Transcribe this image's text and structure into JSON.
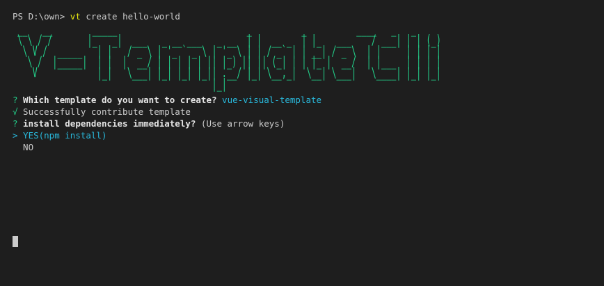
{
  "prompt": {
    "text": "PS D:\\own> ",
    "command": "vt",
    "args": " create hello-world"
  },
  "banner": {
    "art": " __   __        _____                          _          _          ____   _   _\n \\ \\ / /       |_   _|  ___   _ __ ___   _ __  | |  __ _  | |_   ___    / ___| | | (_)\n  \\ V /  _____   | |   / _ \\ | '_ ` _ \\ | '_ \\ | | / _` | | __| / _ \\  | |     | | | |\n   \\ /  |_____|  | |  |  __/ | | | | | || |_) || || (_| | | |_ |  __/  | |___  | | | |\n    V            |_|   \\___| |_| |_| |_|| .__/ |_| \\__,_|  \\__| \\___|   \\____| |_| |_|\n                                        |_|"
  },
  "output": {
    "q1_mark": "?",
    "q1_question": " Which template do you want to create?",
    "q1_answer": " vue-visual-template",
    "success_mark": "√",
    "success_text": " Successfully contribute template",
    "q2_mark": "?",
    "q2_question": " install dependencies immediately?",
    "q2_hint": " (Use arrow keys)",
    "option_pointer": ">",
    "option_yes": " YES(npm install)",
    "option_no": "  NO"
  },
  "colors": {
    "background": "#1e1e1e",
    "text": "#cccccc",
    "yellow": "#e5e510",
    "cyan": "#29b8db",
    "green": "#23d18b"
  },
  "icons": {
    "cursor": "block-cursor"
  }
}
